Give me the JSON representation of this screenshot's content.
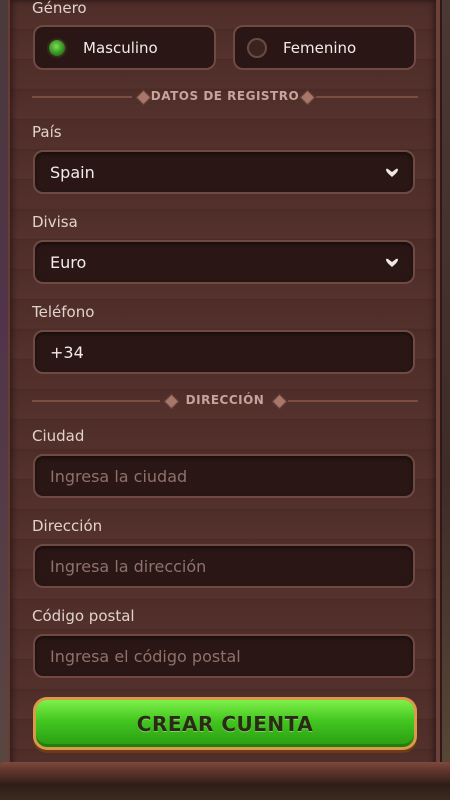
{
  "form": {
    "gender": {
      "label": "Género",
      "options": [
        {
          "label": "Masculino",
          "selected": true
        },
        {
          "label": "Femenino",
          "selected": false
        }
      ]
    },
    "section_registration": "DATOS DE REGISTRO",
    "country": {
      "label": "País",
      "value": "Spain"
    },
    "currency": {
      "label": "Divisa",
      "value": "Euro"
    },
    "phone": {
      "label": "Teléfono",
      "value": "+34"
    },
    "section_address": "DIRECCIÓN",
    "city": {
      "label": "Ciudad",
      "placeholder": "Ingresa la ciudad"
    },
    "address": {
      "label": "Dirección",
      "placeholder": "Ingresa la dirección"
    },
    "postal": {
      "label": "Código postal",
      "placeholder": "Ingresa el código postal"
    },
    "submit_label": "CREAR CUENTA"
  },
  "colors": {
    "panel": "#4f2e2a",
    "field_bg": "#2a1715",
    "field_border": "#6e4a43",
    "cta_green": "#41c61f",
    "cta_border": "#d99a4a"
  },
  "icons": [
    "radio-selected-icon",
    "radio-unselected-icon",
    "chevron-down-icon",
    "diamond-ornament-icon"
  ]
}
